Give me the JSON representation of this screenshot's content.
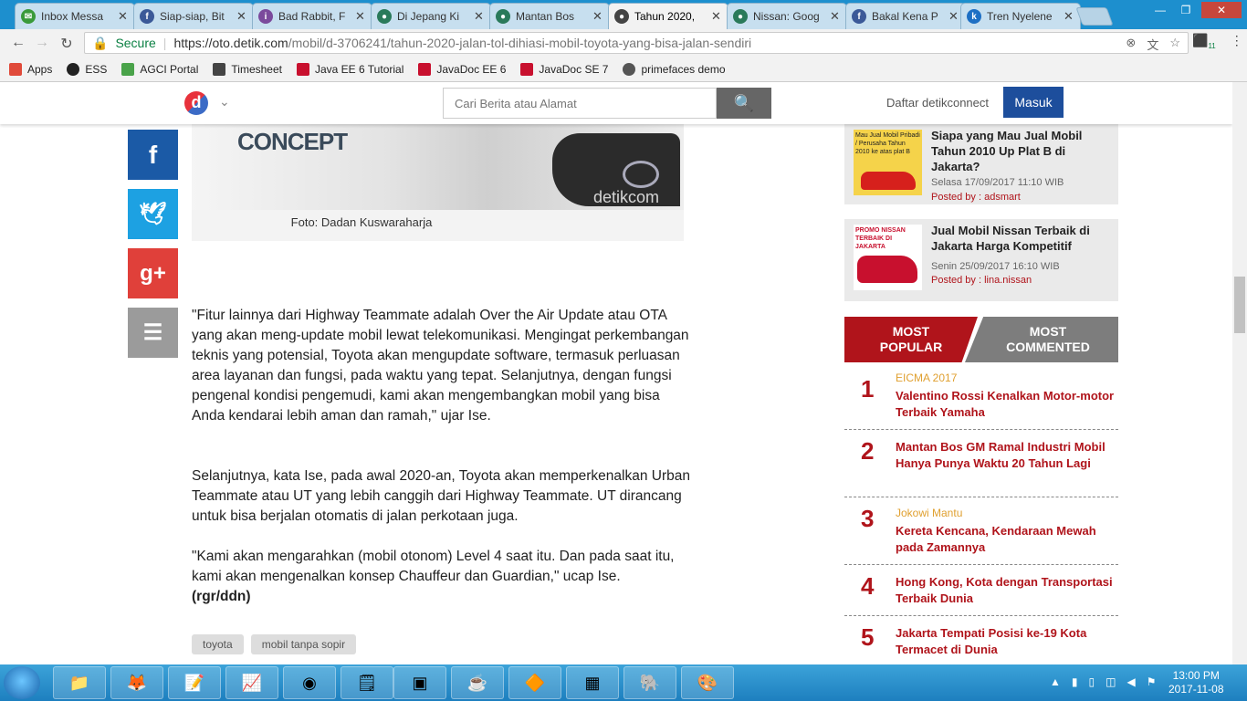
{
  "tabs": [
    {
      "label": "Inbox Messa",
      "color": "#3a9a3a",
      "icon_char": "✉"
    },
    {
      "label": "Siap-siap, Bit",
      "color": "#3b5998",
      "icon_char": "f"
    },
    {
      "label": "Bad Rabbit, F",
      "color": "#7b4a9c",
      "icon_char": "i"
    },
    {
      "label": "Di Jepang Ki",
      "color": "#2a7a5a",
      "icon_char": "●"
    },
    {
      "label": "Mantan Bos",
      "color": "#2a7a5a",
      "icon_char": "●"
    },
    {
      "label": "Tahun 2020,",
      "color": "#444444",
      "icon_char": "●"
    },
    {
      "label": "Nissan: Goog",
      "color": "#2a7a5a",
      "icon_char": "●"
    },
    {
      "label": "Bakal Kena P",
      "color": "#3b5998",
      "icon_char": "f"
    },
    {
      "label": "Tren Nyelene",
      "color": "#1d6fc4",
      "icon_char": "k"
    }
  ],
  "address": {
    "secure_label": "Secure",
    "url_host": "https://oto.detik.com",
    "url_path": "/mobil/d-3706241/tahun-2020-jalan-tol-dihiasi-mobil-toyota-yang-bisa-jalan-sendiri",
    "ext_badge": "11"
  },
  "bookmarks": [
    {
      "label": "Apps",
      "color": "#e04a3a"
    },
    {
      "label": "ESS",
      "color": "#222222"
    },
    {
      "label": "AGCI Portal",
      "color": "#4aa34a"
    },
    {
      "label": "Timesheet",
      "color": "#444444"
    },
    {
      "label": "Java EE 6 Tutorial",
      "color": "#c8102e"
    },
    {
      "label": "JavaDoc EE 6",
      "color": "#c8102e"
    },
    {
      "label": "JavaDoc SE 7",
      "color": "#c8102e"
    },
    {
      "label": "primefaces demo",
      "color": "#555555"
    }
  ],
  "header": {
    "logo_char": "d",
    "search_placeholder": "Cari Berita atau Alamat",
    "daftar": "Daftar detikconnect",
    "masuk": "Masuk"
  },
  "photo": {
    "concept_text": "CONCEPT",
    "watermark": "detikcom",
    "caption": "Foto: Dadan Kuswaraharja"
  },
  "social": [
    {
      "name": "facebook",
      "char": "f",
      "color": "#1b5aa6"
    },
    {
      "name": "twitter",
      "char": "🐦",
      "color": "#1da1e2"
    },
    {
      "name": "googleplus",
      "char": "g+",
      "color": "#e0403a"
    },
    {
      "name": "comment",
      "char": "▤",
      "color": "#9b9b9b"
    }
  ],
  "article": {
    "p1": "\"Fitur lainnya dari Highway Teammate adalah Over the Air Update atau OTA yang akan meng-update mobil lewat telekomunikasi. Mengingat perkembangan teknis yang potensial, Toyota akan mengupdate software, termasuk perluasan area layanan dan fungsi, pada waktu yang tepat. Selanjutnya, dengan fungsi pengenal kondisi pengemudi, kami akan mengembangkan mobil yang bisa Anda kendarai lebih aman dan ramah,\" ujar Ise.",
    "p2": "Selanjutnya, kata Ise, pada awal 2020-an, Toyota akan memperkenalkan Urban Teammate atau UT yang lebih canggih dari Highway Teammate. UT dirancang untuk bisa berjalan otomatis di jalan perkotaan juga.",
    "p3": "\"Kami akan mengarahkan (mobil otonom) Level 4 saat itu. Dan pada saat itu, kami akan mengenalkan konsep Chauffeur dan Guardian,\" ucap Ise.",
    "sign": "(rgr/ddn)",
    "tags": [
      "toyota",
      "mobil tanpa sopir"
    ]
  },
  "ads": [
    {
      "title": "Siapa yang Mau Jual Mobil Tahun 2010 Up Plat B di Jakarta?",
      "date": "Selasa 17/09/2017 11:10 WIB",
      "by": "Posted by : adsmart",
      "thumb_text": "Mau Jual Mobil Pribadi / Perusaha Tahun 2010 ke atas plat B"
    },
    {
      "title": "Jual Mobil Nissan Terbaik di Jakarta Harga Kompetitif",
      "date": "Senin 25/09/2017 16:10 WIB",
      "by": "Posted by : lina.nissan",
      "thumb_text": "PROMO NISSAN TERBAIK DI JAKARTA"
    }
  ],
  "popular_tabs": {
    "most_popular": "MOST POPULAR",
    "most_commented": "MOST COMMENTED"
  },
  "popular": [
    {
      "num": "1",
      "cat": "EICMA 2017",
      "title": "Valentino Rossi Kenalkan Motor-motor Terbaik Yamaha"
    },
    {
      "num": "2",
      "cat": "",
      "title": "Mantan Bos GM Ramal Industri Mobil Hanya Punya Waktu 20 Tahun Lagi"
    },
    {
      "num": "3",
      "cat": "Jokowi Mantu",
      "title": "Kereta Kencana, Kendaraan Mewah pada Zamannya"
    },
    {
      "num": "4",
      "cat": "",
      "title": "Hong Kong, Kota dengan Transportasi Terbaik Dunia"
    },
    {
      "num": "5",
      "cat": "",
      "title": "Jakarta Tempati Posisi ke-19 Kota Termacet di Dunia"
    }
  ],
  "taskbar": {
    "time": "13:00 PM",
    "date": "2017-11-08",
    "apps": [
      "explorer-icon",
      "firefox-icon",
      "notepad-icon",
      "chart-icon",
      "chrome-icon",
      "sticky-notes-icon",
      "terminal-icon",
      "java-ee-ide-icon",
      "vlc-icon",
      "excel-icon",
      "postgres-icon",
      "paint-icon"
    ]
  }
}
